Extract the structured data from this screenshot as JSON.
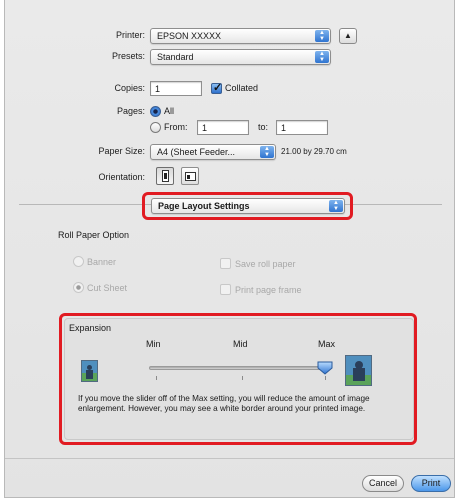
{
  "print_settings": {
    "printer": {
      "label": "Printer:",
      "value": "EPSON XXXXX"
    },
    "presets": {
      "label": "Presets:",
      "value": "Standard"
    },
    "copies": {
      "label": "Copies:",
      "value": "1",
      "collated_label": "Collated",
      "collated": true
    },
    "pages": {
      "label": "Pages:",
      "all_label": "All",
      "from_label": "From:",
      "from_value": "1",
      "to_label": "to:",
      "to_value": "1",
      "selected": "All"
    },
    "paper_size": {
      "label": "Paper Size:",
      "value": "A4 (Sheet Feeder...",
      "dimensions": "21.00 by 29.70 cm"
    },
    "orientation": {
      "label": "Orientation:",
      "selected": "portrait"
    },
    "panel_menu": {
      "value": "Page Layout Settings"
    }
  },
  "roll_paper": {
    "title": "Roll Paper Option",
    "banner_label": "Banner",
    "cut_sheet_label": "Cut Sheet",
    "save_roll_paper_label": "Save roll paper",
    "print_page_frame_label": "Print page frame",
    "selected": "Cut Sheet"
  },
  "expansion": {
    "title": "Expansion",
    "min_label": "Min",
    "mid_label": "Mid",
    "max_label": "Max",
    "slider_setting": "Max",
    "note": "If you move the slider off of the Max setting, you will reduce the amount of image enlargement. However, you may see a white border around your printed image."
  },
  "footer": {
    "cancel_label": "Cancel",
    "print_label": "Print"
  },
  "colors": {
    "highlight": "#e11b22",
    "accent_blue": "#2f74d0"
  }
}
